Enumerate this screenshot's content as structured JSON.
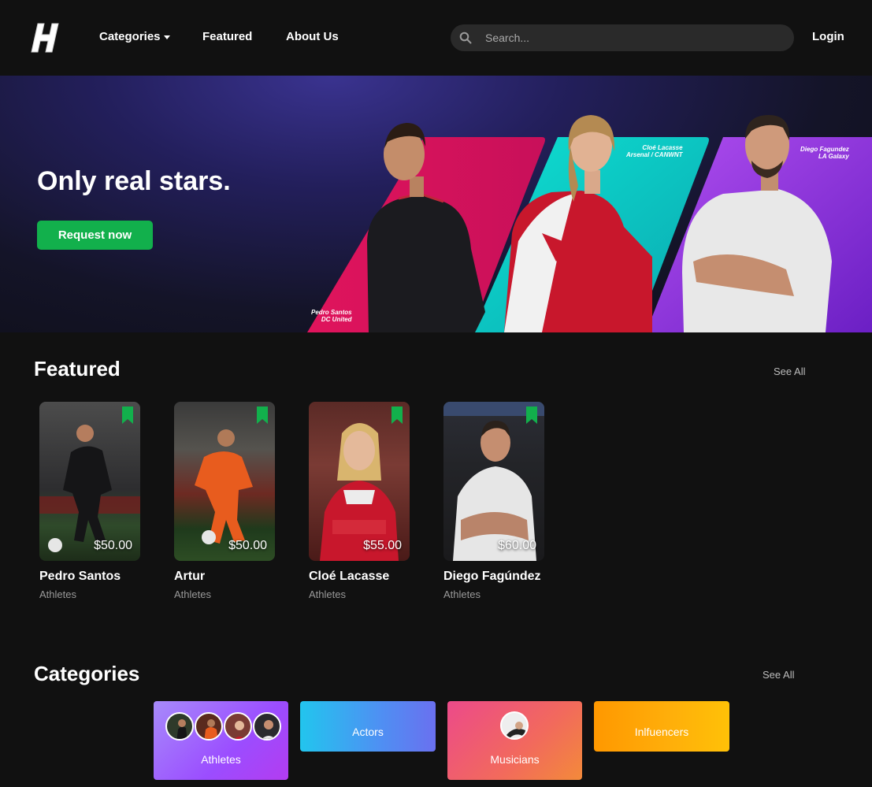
{
  "nav": {
    "logo_letter": "H",
    "links": [
      "Categories",
      "Featured",
      "About Us"
    ],
    "search_placeholder": "Search...",
    "login_label": "Login"
  },
  "hero": {
    "headline": "Only real stars.",
    "cta_label": "Request now",
    "players": [
      {
        "name": "Pedro Santos",
        "team": "DC United",
        "color": "#e5175f"
      },
      {
        "name": "Cloé Lacasse",
        "team": "Arsenal / CANWNT",
        "color": "#12d6c9"
      },
      {
        "name": "Diego Fagundez",
        "team": "LA Galaxy",
        "color": "#9d3fe8"
      }
    ]
  },
  "featured": {
    "title": "Featured",
    "see_all": "See All",
    "items": [
      {
        "name": "Pedro Santos",
        "category": "Athletes",
        "price": "$50.00"
      },
      {
        "name": "Artur",
        "category": "Athletes",
        "price": "$50.00"
      },
      {
        "name": "Cloé Lacasse",
        "category": "Athletes",
        "price": "$55.00"
      },
      {
        "name": "Diego Fagúndez",
        "category": "Athletes",
        "price": "$60.00"
      }
    ]
  },
  "categories": {
    "title": "Categories",
    "see_all": "See All",
    "items": [
      {
        "label": "Athletes"
      },
      {
        "label": "Actors"
      },
      {
        "label": "Musicians"
      },
      {
        "label": "Inlfuencers"
      }
    ]
  },
  "colors": {
    "accent_green": "#12b04c",
    "background": "#111111"
  }
}
